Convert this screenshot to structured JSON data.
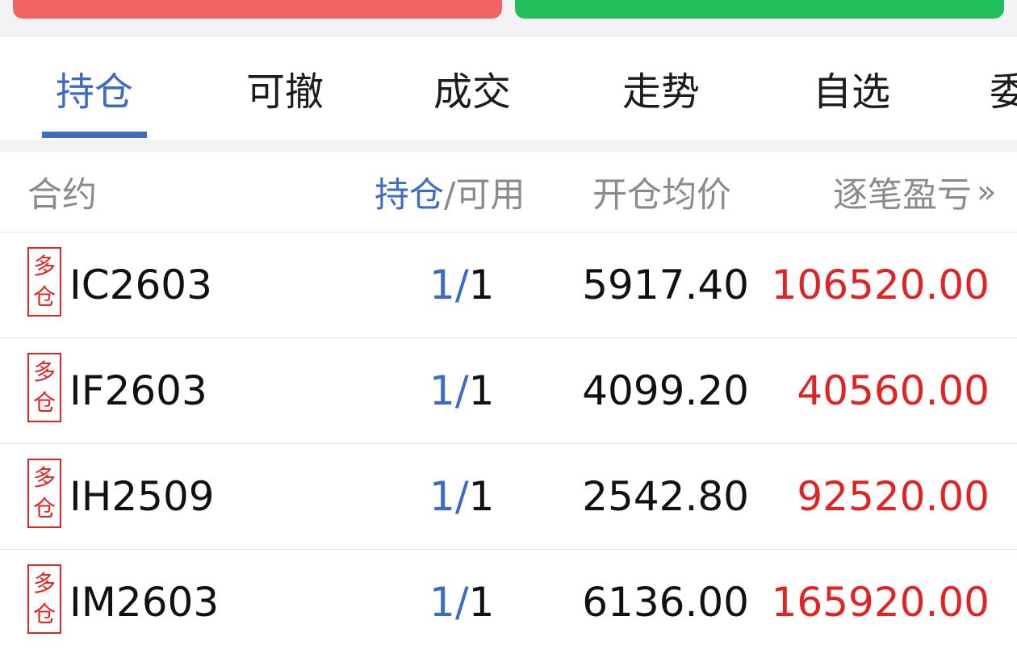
{
  "tabs": [
    {
      "label": "持仓",
      "active": true
    },
    {
      "label": "可撤",
      "active": false
    },
    {
      "label": "成交",
      "active": false
    },
    {
      "label": "走势",
      "active": false
    },
    {
      "label": "自选",
      "active": false
    },
    {
      "label": "委",
      "active": false
    }
  ],
  "table": {
    "headers": {
      "contract": "合约",
      "position_highlight": "持仓",
      "position_rest": "/可用",
      "avg_open_price": "开仓均价",
      "pnl": "逐笔盈亏",
      "more_icon": "double-chevron-right-icon"
    },
    "rows": [
      {
        "badge_top": "多",
        "badge_bottom": "仓",
        "contract": "IC2603",
        "held": "1",
        "sep": "/",
        "available": "1",
        "avg_price": "5917.40",
        "pnl": "106520.00"
      },
      {
        "badge_top": "多",
        "badge_bottom": "仓",
        "contract": "IF2603",
        "held": "1",
        "sep": "/",
        "available": "1",
        "avg_price": "4099.20",
        "pnl": "40560.00"
      },
      {
        "badge_top": "多",
        "badge_bottom": "仓",
        "contract": "IH2509",
        "held": "1",
        "sep": "/",
        "available": "1",
        "avg_price": "2542.80",
        "pnl": "92520.00"
      },
      {
        "badge_top": "多",
        "badge_bottom": "仓",
        "contract": "IM2603",
        "held": "1",
        "sep": "/",
        "available": "1",
        "avg_price": "6136.00",
        "pnl": "165920.00"
      }
    ]
  },
  "colors": {
    "accent_blue": "#3d6bc4",
    "profit_red": "#e02424",
    "sell_button": "#f26464",
    "buy_button": "#21bf5c"
  }
}
